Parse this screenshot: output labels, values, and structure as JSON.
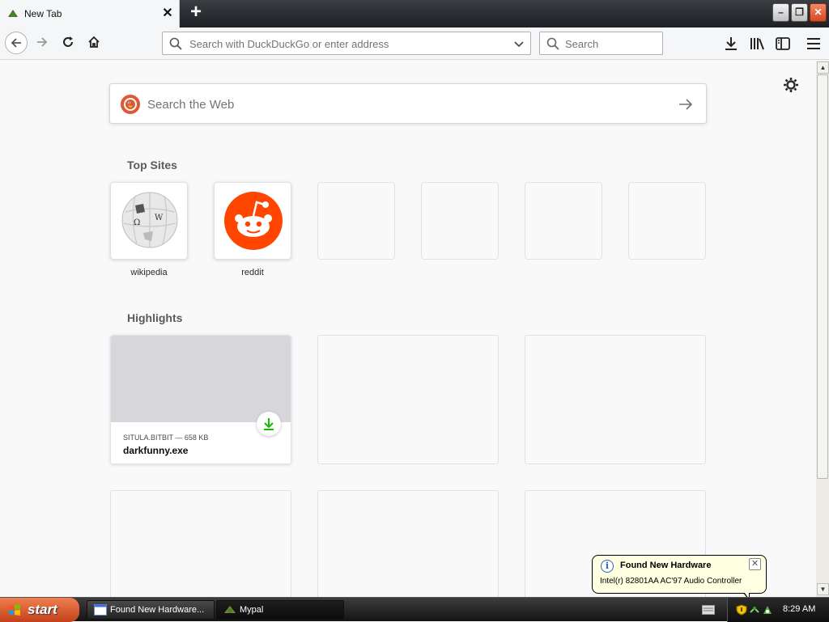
{
  "browser": {
    "tab": {
      "title": "New Tab",
      "close": "✕"
    },
    "new_tab": "+",
    "window_controls": {
      "minimize": "–",
      "maximize": "❐",
      "close": "✕"
    },
    "urlbar": {
      "placeholder": "Search with DuckDuckGo or enter address"
    },
    "searchbar": {
      "placeholder": "Search"
    }
  },
  "newtab": {
    "web_search_placeholder": "Search the Web",
    "top_sites_title": "Top Sites",
    "top_sites": [
      {
        "label": "wikipedia",
        "icon": "wikipedia-logo"
      },
      {
        "label": "reddit",
        "icon": "reddit-logo"
      },
      {
        "label": ""
      },
      {
        "label": ""
      },
      {
        "label": ""
      },
      {
        "label": ""
      }
    ],
    "highlights_title": "Highlights",
    "highlights": [
      {
        "meta": "SITULA.BITBIT — 658 KB",
        "filename": "darkfunny.exe",
        "icon": "download-icon"
      }
    ]
  },
  "notification": {
    "title": "Found New Hardware",
    "body": "Intel(r) 82801AA AC'97 Audio Controller",
    "info_glyph": "i",
    "close": "✕"
  },
  "taskbar": {
    "start_label": "start",
    "tasks": [
      {
        "label": "Found New Hardware..."
      },
      {
        "label": "Mypal"
      }
    ],
    "clock": "8:29 AM"
  },
  "colors": {
    "accent_download": "#12bc00",
    "duckduckgo": "#de5833",
    "reddit": "#ff4500",
    "start_button": "#d8562a"
  }
}
